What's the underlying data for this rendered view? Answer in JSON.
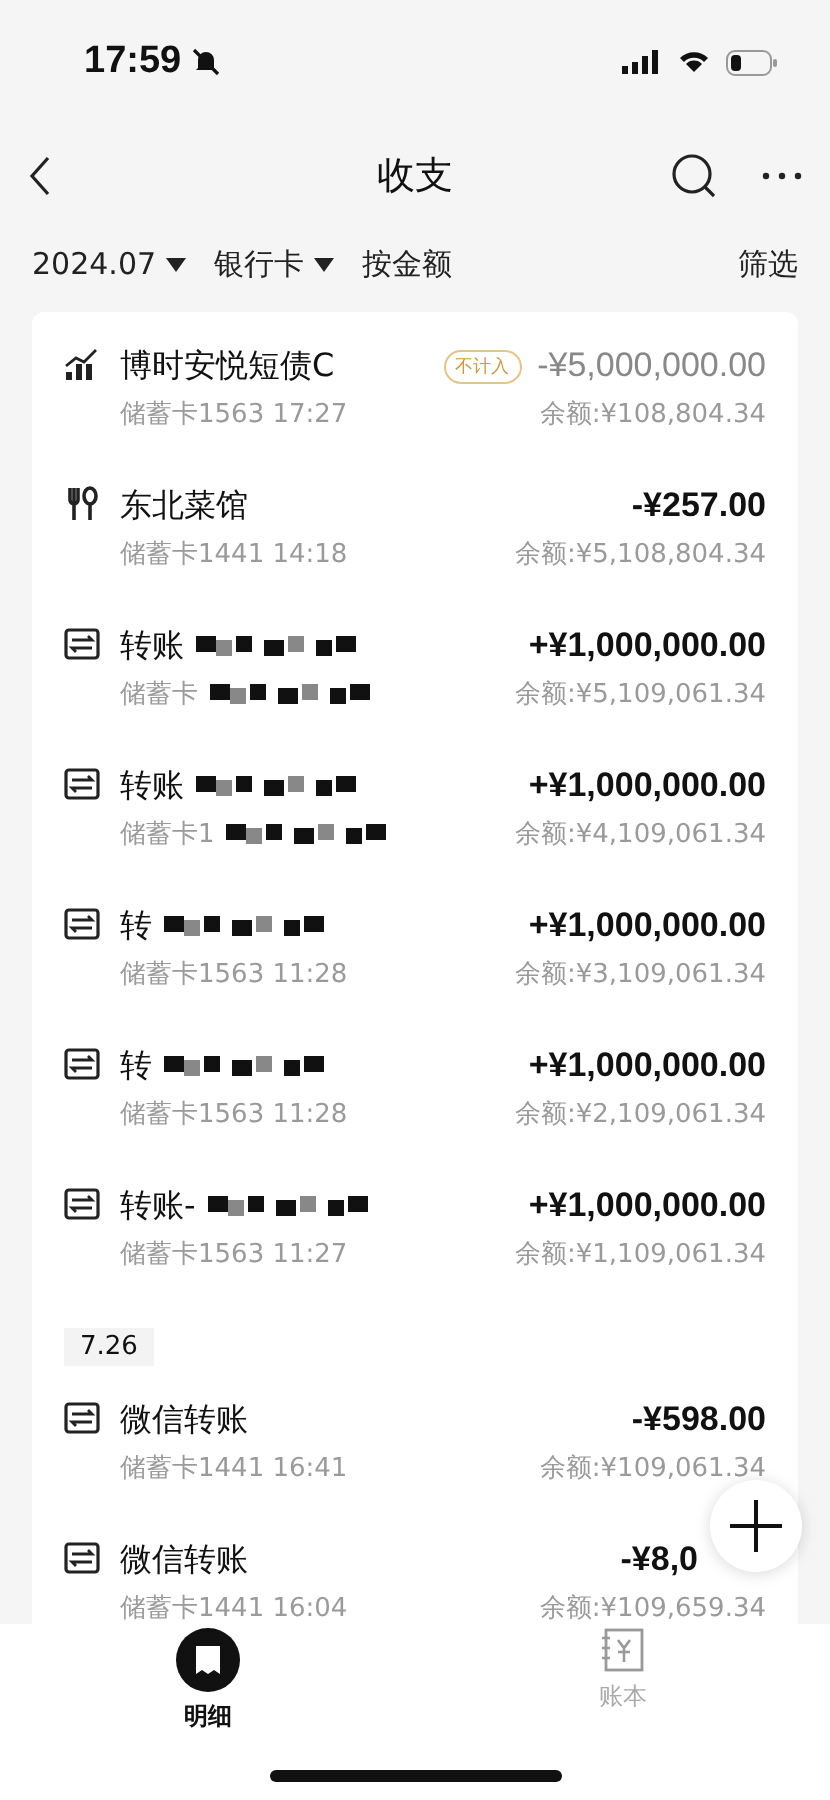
{
  "status_bar": {
    "time": "17:59"
  },
  "nav": {
    "title": "收支"
  },
  "filters": [
    {
      "label": "2024.07",
      "dropdown": true
    },
    {
      "label": "银行卡",
      "dropdown": true
    },
    {
      "label": "按金额",
      "dropdown": false
    }
  ],
  "filter_action": "筛选",
  "sections": [
    {
      "items": [
        {
          "kind": "fund",
          "title": "博时安悦短债C",
          "redacted": false,
          "badge": "不计入",
          "amount": "-¥5,000,000.00",
          "muted": true,
          "sub": "储蓄卡1563 17:27",
          "balance": "余额:¥108,804.34"
        },
        {
          "kind": "food",
          "title": "东北菜馆",
          "redacted": false,
          "amount": "-¥257.00",
          "muted": false,
          "sub": "储蓄卡1441 14:18",
          "balance": "余额:¥5,108,804.34"
        },
        {
          "kind": "transfer",
          "title": "转账",
          "redacted": true,
          "amount": "+¥1,000,000.00",
          "muted": false,
          "sub": "储蓄卡",
          "sub_redacted": true,
          "balance": "余额:¥5,109,061.34"
        },
        {
          "kind": "transfer",
          "title": "转账",
          "redacted": true,
          "amount": "+¥1,000,000.00",
          "muted": false,
          "sub": "储蓄卡1",
          "sub_redacted": true,
          "balance": "余额:¥4,109,061.34"
        },
        {
          "kind": "transfer",
          "title": "转",
          "redacted": true,
          "amount": "+¥1,000,000.00",
          "muted": false,
          "sub": "储蓄卡1563 11:28",
          "sub_redacted": false,
          "balance": "余额:¥3,109,061.34"
        },
        {
          "kind": "transfer",
          "title": "转",
          "redacted": true,
          "amount": "+¥1,000,000.00",
          "muted": false,
          "sub": "储蓄卡1563 11:28",
          "sub_redacted": false,
          "balance": "余额:¥2,109,061.34"
        },
        {
          "kind": "transfer",
          "title": "转账-",
          "redacted": true,
          "amount": "+¥1,000,000.00",
          "muted": false,
          "sub": "储蓄卡1563 11:27",
          "sub_redacted": false,
          "balance": "余额:¥1,109,061.34"
        }
      ]
    },
    {
      "date": "7.26",
      "items": [
        {
          "kind": "transfer",
          "title": "微信转账",
          "redacted": false,
          "amount": "-¥598.00",
          "muted": false,
          "sub": "储蓄卡1441 16:41",
          "balance": "余额:¥109,061.34"
        },
        {
          "kind": "transfer",
          "title": "微信转账",
          "redacted": false,
          "amount": "-¥8,0",
          "muted": false,
          "sub": "储蓄卡1441 16:04",
          "balance": "余额:¥109,659.34"
        }
      ]
    }
  ],
  "tabs": [
    {
      "label": "明细",
      "selected": true
    },
    {
      "label": "账本",
      "selected": false
    }
  ]
}
